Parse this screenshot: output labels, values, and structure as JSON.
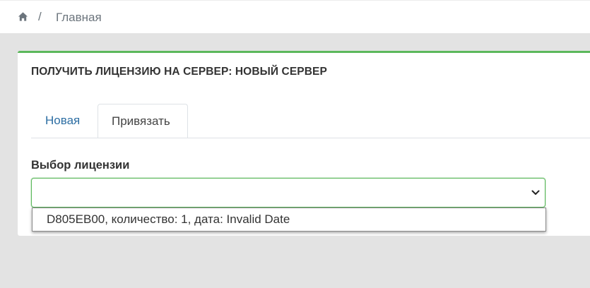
{
  "breadcrumb": {
    "home_icon": "home-icon",
    "separator": "/",
    "current": "Главная"
  },
  "card": {
    "accent_color": "#5cb85c",
    "title": "ПОЛУЧИТЬ ЛИЦЕНЗИЮ НА СЕРВЕР: НОВЫЙ СЕРВЕР",
    "tabs": [
      {
        "label": "Новая",
        "active": false
      },
      {
        "label": "Привязать",
        "active": true
      }
    ],
    "license_field": {
      "label": "Выбор лицензии",
      "value": "",
      "chevron_icon": "chevron-down-icon",
      "options": [
        "D805EB00, количество: 1, дата: Invalid Date"
      ]
    }
  }
}
